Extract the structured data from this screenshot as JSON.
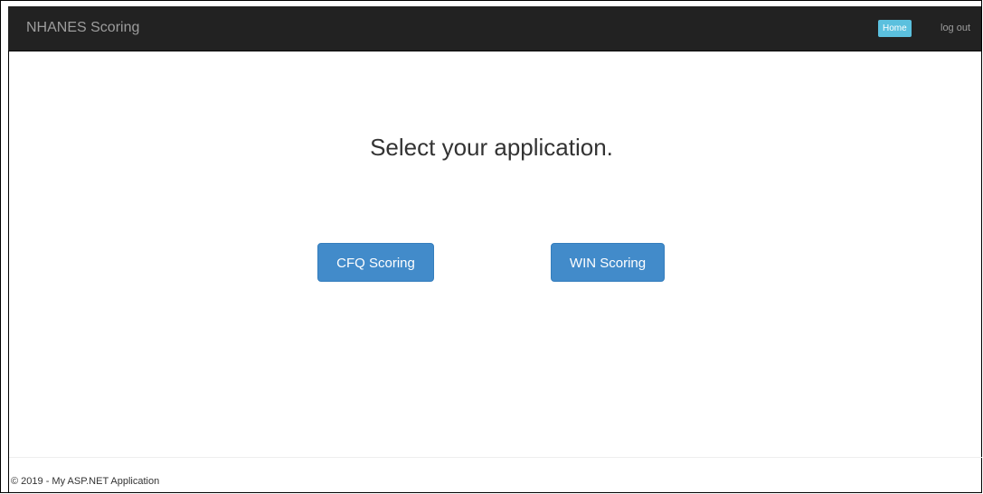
{
  "navbar": {
    "brand": "NHANES Scoring",
    "home_label": "Home",
    "logout_label": "log out"
  },
  "main": {
    "heading": "Select your application.",
    "buttons": [
      {
        "label": "CFQ Scoring"
      },
      {
        "label": "WIN Scoring"
      }
    ]
  },
  "footer": {
    "text": "© 2019 - My ASP.NET Application"
  },
  "colors": {
    "navbar_bg": "#222222",
    "primary": "#428bca",
    "home_active": "#5bc0de"
  }
}
